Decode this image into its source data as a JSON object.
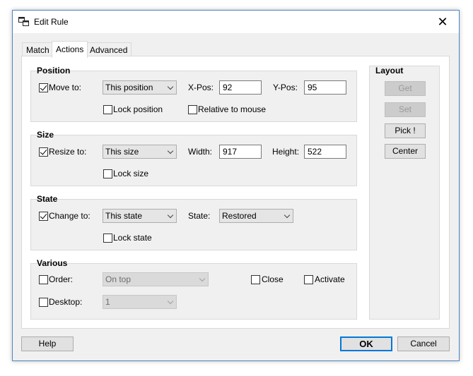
{
  "window": {
    "title": "Edit Rule",
    "icon": "window-settings-icon",
    "close_glyph": "✕"
  },
  "tabs": [
    {
      "label": "Match"
    },
    {
      "label": "Actions"
    },
    {
      "label": "Advanced"
    }
  ],
  "active_tab": "Actions",
  "position": {
    "title": "Position",
    "move_to": {
      "label": "Move to:",
      "checked": true
    },
    "mode": "This position",
    "xpos_label": "X-Pos:",
    "xpos": "92",
    "ypos_label": "Y-Pos:",
    "ypos": "95",
    "lock_label": "Lock position",
    "lock_checked": false,
    "relative_label": "Relative to mouse",
    "relative_checked": false
  },
  "size": {
    "title": "Size",
    "resize_to": {
      "label": "Resize to:",
      "checked": true
    },
    "mode": "This size",
    "width_label": "Width:",
    "width": "917",
    "height_label": "Height:",
    "height": "522",
    "lock_label": "Lock size",
    "lock_checked": false
  },
  "state": {
    "title": "State",
    "change_to": {
      "label": "Change to:",
      "checked": true
    },
    "mode": "This state",
    "state_label": "State:",
    "state_value": "Restored",
    "lock_label": "Lock state",
    "lock_checked": false
  },
  "various": {
    "title": "Various",
    "order": {
      "label": "Order:",
      "checked": false,
      "value": "On top"
    },
    "close": {
      "label": "Close",
      "checked": false
    },
    "activate": {
      "label": "Activate",
      "checked": false
    },
    "desktop": {
      "label": "Desktop:",
      "checked": false,
      "value": "1"
    }
  },
  "layout": {
    "title": "Layout",
    "get_label": "Get",
    "set_label": "Set",
    "pick_label": "Pick !",
    "center_label": "Center"
  },
  "footer": {
    "help_label": "Help",
    "ok_label": "OK",
    "cancel_label": "Cancel"
  }
}
